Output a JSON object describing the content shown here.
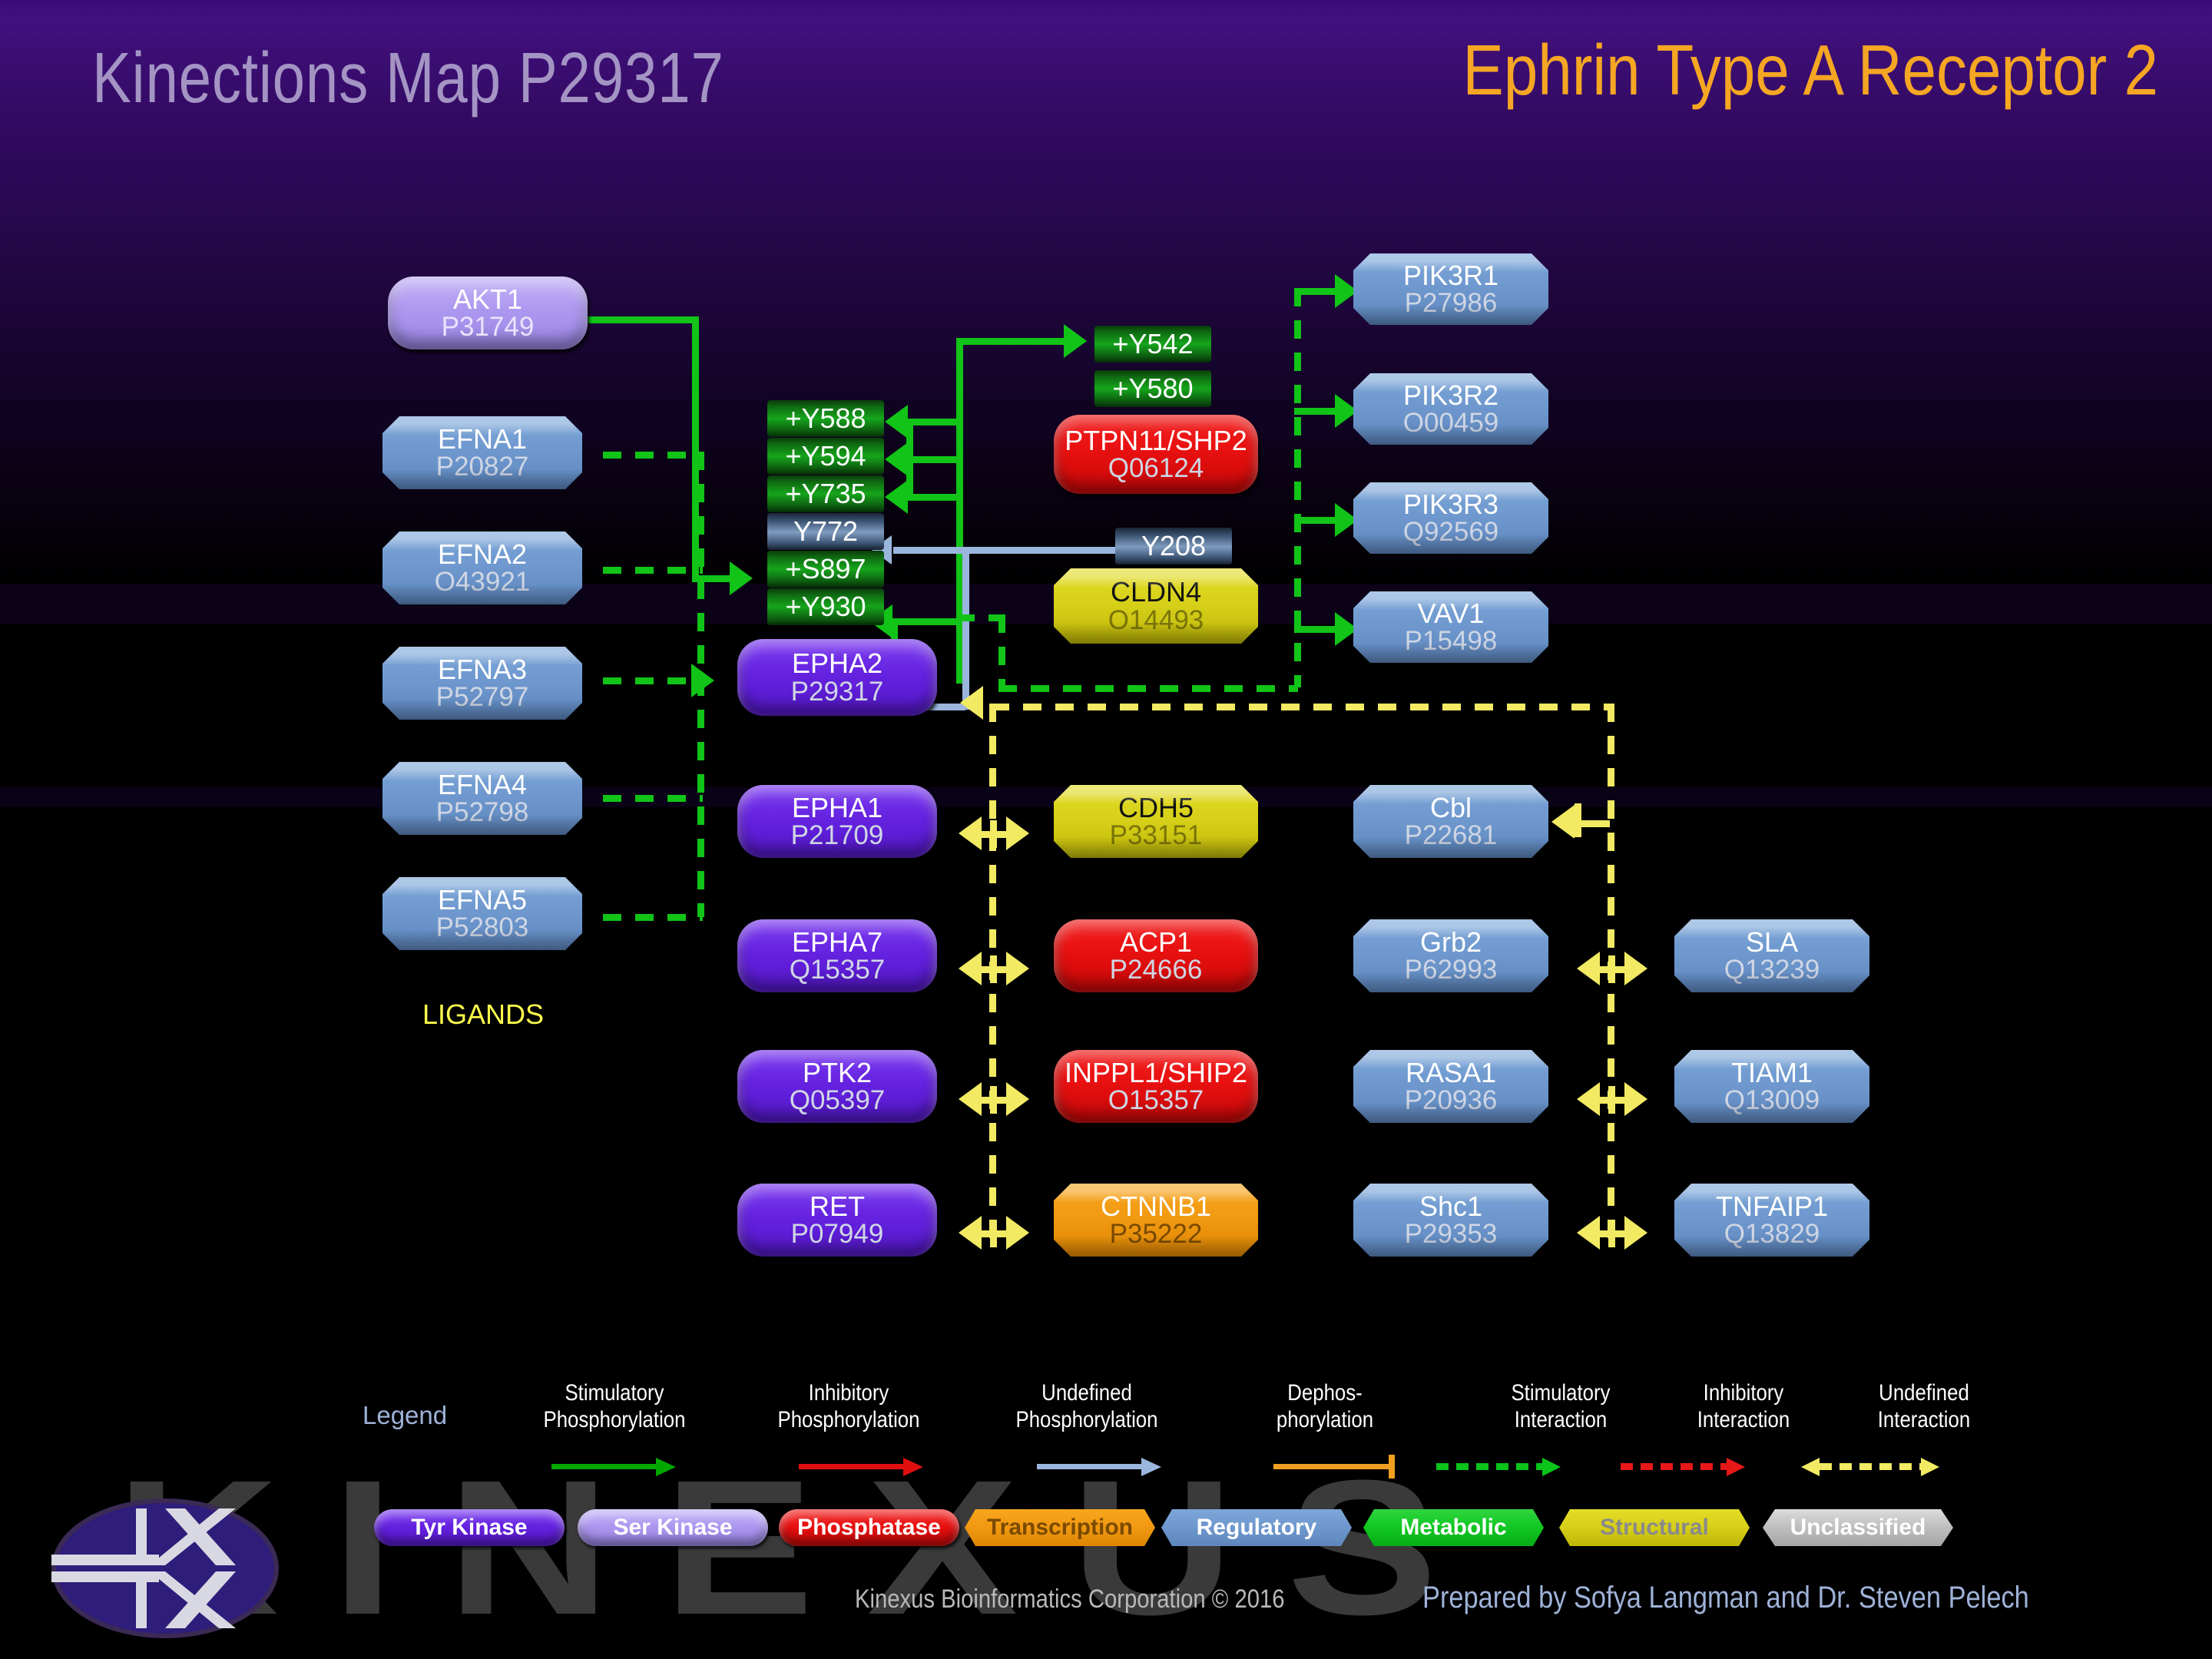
{
  "header": {
    "title_left": "Kinections Map P29317",
    "title_right": "Ephrin Type A Receptor 2"
  },
  "labels": {
    "ligands": "LIGANDS",
    "legend": "Legend"
  },
  "nodes": {
    "akt1": {
      "name": "AKT1",
      "acc": "P31749"
    },
    "efna1": {
      "name": "EFNA1",
      "acc": "P20827"
    },
    "efna2": {
      "name": "EFNA2",
      "acc": "O43921"
    },
    "efna3": {
      "name": "EFNA3",
      "acc": "P52797"
    },
    "efna4": {
      "name": "EFNA4",
      "acc": "P52798"
    },
    "efna5": {
      "name": "EFNA5",
      "acc": "P52803"
    },
    "epha2": {
      "name": "EPHA2",
      "acc": "P29317"
    },
    "ptpn11": {
      "name": "PTPN11/SHP2",
      "acc": "Q06124"
    },
    "cldn4": {
      "name": "CLDN4",
      "acc": "O14493"
    },
    "pik3r1": {
      "name": "PIK3R1",
      "acc": "P27986"
    },
    "pik3r2": {
      "name": "PIK3R2",
      "acc": "O00459"
    },
    "pik3r3": {
      "name": "PIK3R3",
      "acc": "Q92569"
    },
    "vav1": {
      "name": "VAV1",
      "acc": "P15498"
    },
    "epha1": {
      "name": "EPHA1",
      "acc": "P21709"
    },
    "epha7": {
      "name": "EPHA7",
      "acc": "Q15357"
    },
    "ptk2": {
      "name": "PTK2",
      "acc": "Q05397"
    },
    "ret": {
      "name": "RET",
      "acc": "P07949"
    },
    "cdh5": {
      "name": "CDH5",
      "acc": "P33151"
    },
    "acp1": {
      "name": "ACP1",
      "acc": "P24666"
    },
    "inppl1": {
      "name": "INPPL1/SHIP2",
      "acc": "O15357"
    },
    "ctnnb1": {
      "name": "CTNNB1",
      "acc": "P35222"
    },
    "cbl": {
      "name": "Cbl",
      "acc": "P22681"
    },
    "grb2": {
      "name": "Grb2",
      "acc": "P62993"
    },
    "rasa1": {
      "name": "RASA1",
      "acc": "P20936"
    },
    "shc1": {
      "name": "Shc1",
      "acc": "P29353"
    },
    "sla": {
      "name": "SLA",
      "acc": "Q13239"
    },
    "tiam1": {
      "name": "TIAM1",
      "acc": "Q13009"
    },
    "tnfaip1": {
      "name": "TNFAIP1",
      "acc": "Q13829"
    }
  },
  "phosphosites": {
    "y542": "+Y542",
    "y580": "+Y580",
    "y588": "+Y588",
    "y594": "+Y594",
    "y735": "+Y735",
    "y772": "Y772",
    "s897": "+S897",
    "y930": "+Y930",
    "y208": "Y208"
  },
  "legend_items": [
    {
      "label": "Stimulatory\nPhosphorylation",
      "line": "solid",
      "color": "#00a800",
      "head": "arrow"
    },
    {
      "label": "Inhibitory\nPhosphorylation",
      "line": "solid",
      "color": "#e01010",
      "head": "arrow"
    },
    {
      "label": "Undefined\nPhosphorylation",
      "line": "solid",
      "color": "#9ab6dd",
      "head": "arrow"
    },
    {
      "label": "Dephos-\nphorylation",
      "line": "solid",
      "color": "#f0a020",
      "head": "tbar"
    },
    {
      "label": "Stimulatory\nInteraction",
      "line": "dashed",
      "color": "#0ac41a",
      "head": "arrow"
    },
    {
      "label": "Inhibitory\nInteraction",
      "line": "dashed",
      "color": "#e81818",
      "head": "arrow"
    },
    {
      "label": "Undefined\nInteraction",
      "line": "dashed",
      "color": "#f2ea62",
      "head": "double"
    }
  ],
  "legend_lines": {
    "stim_phos": "Stimulatory",
    "stim_phos2": "Phosphorylation",
    "inh_phos": "Inhibitory",
    "inh_phos2": "Phosphorylation",
    "und_phos": "Undefined",
    "und_phos2": "Phosphorylation",
    "deph": "Dephos-",
    "deph2": "phorylation",
    "stim_int": "Stimulatory",
    "stim_int2": "Interaction",
    "inh_int": "Inhibitory",
    "inh_int2": "Interaction",
    "und_int": "Undefined",
    "und_int2": "Interaction"
  },
  "key_chips": [
    {
      "label": "Tyr Kinase",
      "color": "#6522e0",
      "shape": "round"
    },
    {
      "label": "Ser Kinase",
      "color": "#ad98f0",
      "shape": "round"
    },
    {
      "label": "Phosphatase",
      "color": "#e81010",
      "shape": "round"
    },
    {
      "label": "Transcription",
      "color": "#f09810",
      "shape": "oct"
    },
    {
      "label": "Regulatory",
      "color": "#6d97cd",
      "shape": "oct"
    },
    {
      "label": "Metabolic",
      "color": "#10c622",
      "shape": "oct"
    },
    {
      "label": "Structural",
      "color": "#d6cf18",
      "shape": "oct"
    },
    {
      "label": "Unclassified",
      "color": "#bdbdbd",
      "shape": "hex"
    }
  ],
  "footer": {
    "copyright": "Kinexus Bioinformatics Corporation © 2016",
    "credits": "Prepared by Sofya Langman and Dr. Steven Pelech",
    "watermark": "KINEXUS"
  },
  "colors": {
    "stimulatory": "#11c417",
    "undefined_phos": "#9ab6dd",
    "interaction": "#f2ea62",
    "title_left": "#a394c4",
    "title_right": "#f5a623",
    "ligands": "#ffff4d"
  }
}
